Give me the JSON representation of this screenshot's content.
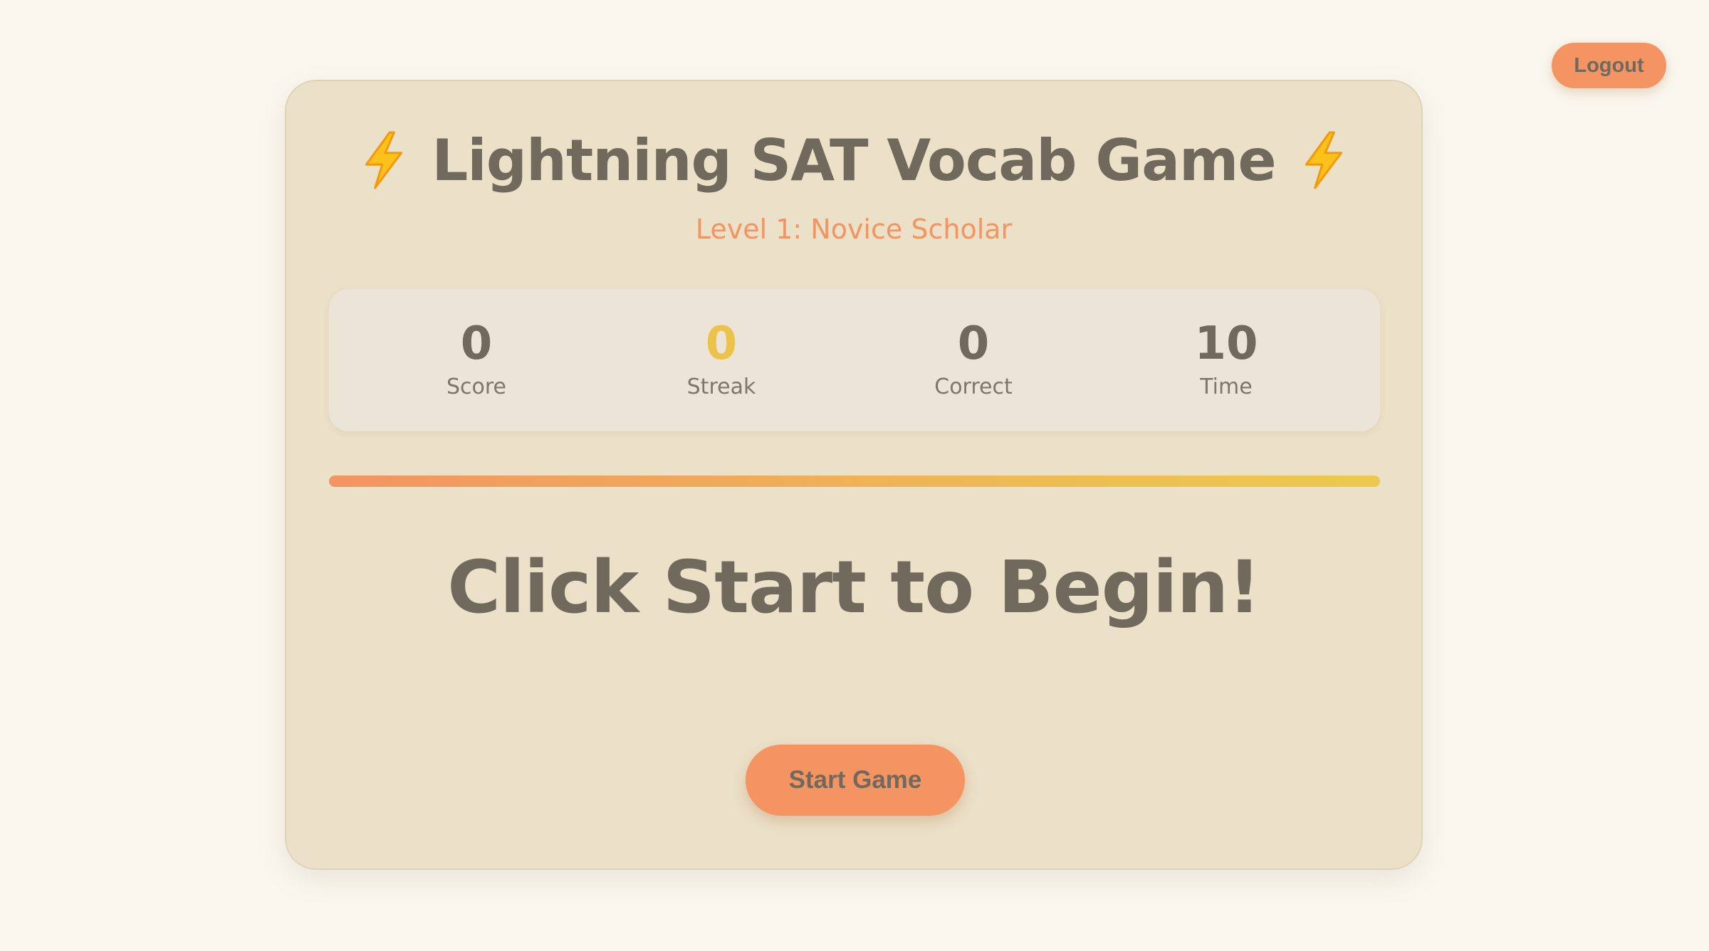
{
  "header": {
    "logout_label": "Logout"
  },
  "game": {
    "title": "Lightning SAT Vocab Game",
    "title_icon": "lightning-bolt-icon",
    "level": "Level 1: Novice Scholar",
    "stats": [
      {
        "value": "0",
        "label": "Score"
      },
      {
        "value": "0",
        "label": "Streak"
      },
      {
        "value": "0",
        "label": "Correct"
      },
      {
        "value": "10",
        "label": "Time"
      }
    ],
    "timer_progress_fraction": 1.0,
    "prompt": "Click Start to Begin!",
    "start_label": "Start Game"
  },
  "colors": {
    "background": "#faf7ef",
    "card": "#ebe0c8",
    "stats_box": "#ede4d8",
    "accent": "#f39462",
    "streak": "#ecc34a",
    "text": "#72695d"
  }
}
